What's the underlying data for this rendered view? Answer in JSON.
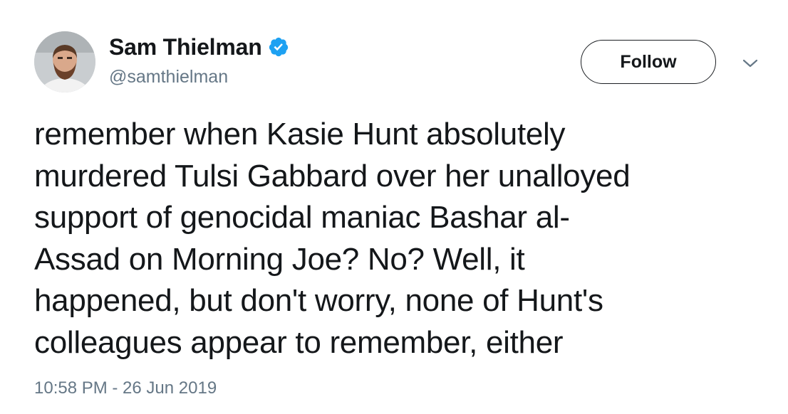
{
  "author": {
    "display_name": "Sam Thielman",
    "handle": "@samthielman",
    "verified": true,
    "verified_icon": "verified-badge-icon",
    "verified_color": "#1da1f2"
  },
  "header": {
    "follow_label": "Follow",
    "menu_icon": "chevron-down-icon"
  },
  "tweet": {
    "lines": [
      "remember when Kasie Hunt absolutely",
      "murdered Tulsi Gabbard over her unalloyed",
      "support of genocidal maniac Bashar al-",
      "Assad on Morning Joe? No? Well, it",
      "happened, but don't worry, none of Hunt's",
      "colleagues appear to remember, either"
    ],
    "timestamp": "10:58 PM - 26 Jun 2019"
  },
  "colors": {
    "text": "#14171a",
    "secondary": "#657786",
    "accent": "#1da1f2"
  }
}
